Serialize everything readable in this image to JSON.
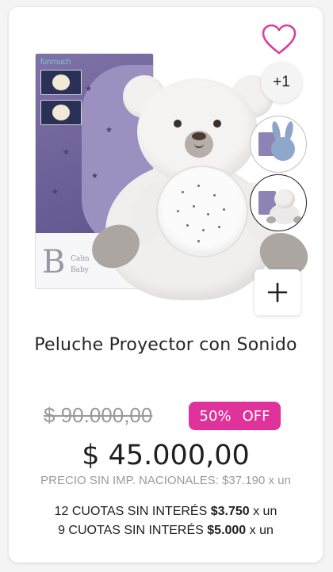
{
  "product": {
    "title": "Peluche Proyector con Sonido",
    "image_alt": "Peluche proyector oso blanco con caja",
    "box_brand": "funmuch",
    "box_logo_letter": "B",
    "box_logo_text_1": "Calm",
    "box_logo_text_2": "Baby"
  },
  "gallery": {
    "more_count_label": "+1",
    "favorite_icon": "heart-outline-icon",
    "add_icon": "plus-icon"
  },
  "pricing": {
    "old_price": "$ 90.000,00",
    "discount_percent": "50%",
    "discount_word": "OFF",
    "price": "$ 45.000,00",
    "tax_note": "PRECIO SIN IMP. NACIONALES: $37.190 x un"
  },
  "installments": [
    {
      "prefix": "12 CUOTAS SIN INTERÉS",
      "amount": "$3.750",
      "suffix": "x un"
    },
    {
      "prefix": "9 CUOTAS SIN INTERÉS",
      "amount": "$5.000",
      "suffix": "x un"
    }
  ],
  "colors": {
    "accent_pink": "#e0329b",
    "favorite_icon": "#d93ea0",
    "text": "#1f1f1f",
    "muted": "#9b9b9b"
  }
}
